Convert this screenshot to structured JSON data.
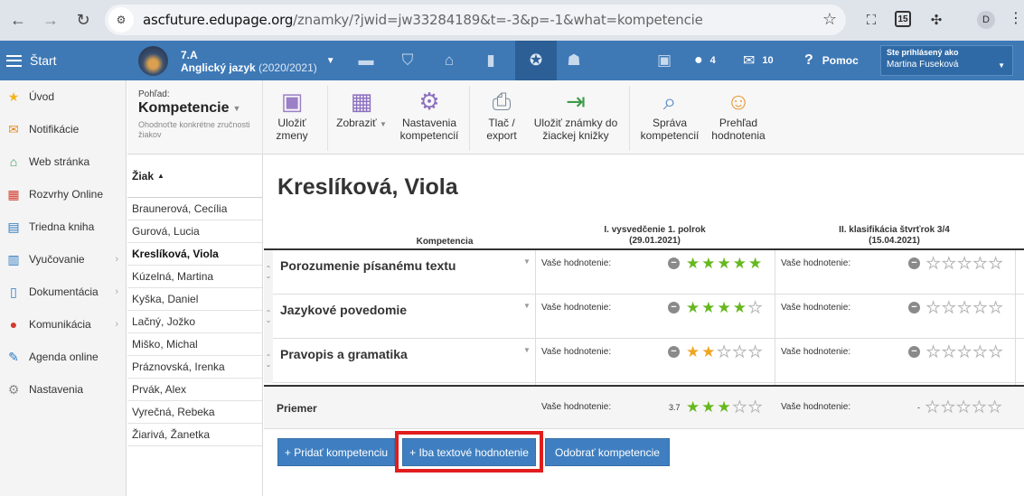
{
  "browser": {
    "url_host": "ascfuture.edupage.org",
    "url_path": "/znamky/?jwid=jw33284189&t=-3&p=-1&what=kompetencie",
    "ext_badge": "15",
    "profile_initial": "D"
  },
  "appbar": {
    "start_label": "Štart",
    "class_name": "7.A",
    "subject": "Anglický jazyk",
    "year": "(2020/2021)",
    "messages_count": "4",
    "mail_count": "10",
    "help_label": "Pomoc",
    "user_caption": "Ste prihlásený ako",
    "user_name": "Martina Fuseková"
  },
  "sidebar": {
    "items": [
      {
        "label": "Úvod",
        "icon": "star-icon"
      },
      {
        "label": "Notifikácie",
        "icon": "envelope-icon"
      },
      {
        "label": "Web stránka",
        "icon": "house-icon"
      },
      {
        "label": "Rozvrhy Online",
        "icon": "timetable-icon"
      },
      {
        "label": "Triedna kniha",
        "icon": "book-icon"
      },
      {
        "label": "Vyučovanie",
        "icon": "open-book-icon"
      },
      {
        "label": "Dokumentácia",
        "icon": "document-icon"
      },
      {
        "label": "Komunikácia",
        "icon": "chat-icon"
      },
      {
        "label": "Agenda online",
        "icon": "pen-icon"
      },
      {
        "label": "Nastavenia",
        "icon": "gear-icon"
      }
    ]
  },
  "toolbar": {
    "view_caption": "Pohľad:",
    "view_value": "Kompetencie",
    "view_desc": "Ohodnoťte konkrétne zručnosti žiakov",
    "save": "Uložiť zmeny",
    "show": "Zobraziť",
    "settings": "Nastavenia kompetencií",
    "print": "Tlač / export",
    "save_book": "Uložiť známky do žiackej knižky",
    "manage": "Správa kompetencií",
    "overview": "Prehľad hodnotenia"
  },
  "students": {
    "header": "Žiak",
    "list": [
      "Braunerová, Cecília",
      "Gurová, Lucia",
      "Kreslíková, Viola",
      "Kúzelná, Martina",
      "Kyška, Daniel",
      "Lačný, Jožko",
      "Miško, Michal",
      "Práznovská, Irenka",
      "Prvák, Alex",
      "Vyrečná, Rebeka",
      "Žiarivá, Žanetka"
    ],
    "selected": "Kreslíková, Viola"
  },
  "main": {
    "student_title": "Kreslíková, Viola",
    "col_competence": "Kompetencia",
    "col1_title": "I. vysvedčenie 1. polrok",
    "col1_date": "(29.01.2021)",
    "col2_title": "II. klasifikácia štvrťrok 3/4",
    "col2_date": "(15.04.2021)",
    "rating_label": "Vaše hodnotenie:",
    "competencies": [
      {
        "name": "Porozumenie písanému textu",
        "col1": {
          "filled": 5,
          "color": "green"
        },
        "col2": {
          "filled": 0
        }
      },
      {
        "name": "Jazykové povedomie",
        "col1": {
          "filled": 4,
          "color": "green"
        },
        "col2": {
          "filled": 0
        }
      },
      {
        "name": "Pravopis a gramatika",
        "col1": {
          "filled": 2,
          "color": "orange"
        },
        "col2": {
          "filled": 0
        }
      }
    ],
    "average_label": "Priemer",
    "average_col1_value": "3.7",
    "average_col1_filled": 3,
    "average_col2_value": "-",
    "buttons": {
      "add": "+ Pridať kompetenciu",
      "text_only": "+ Iba textové hodnotenie",
      "remove": "Odobrať kompetencie"
    }
  }
}
